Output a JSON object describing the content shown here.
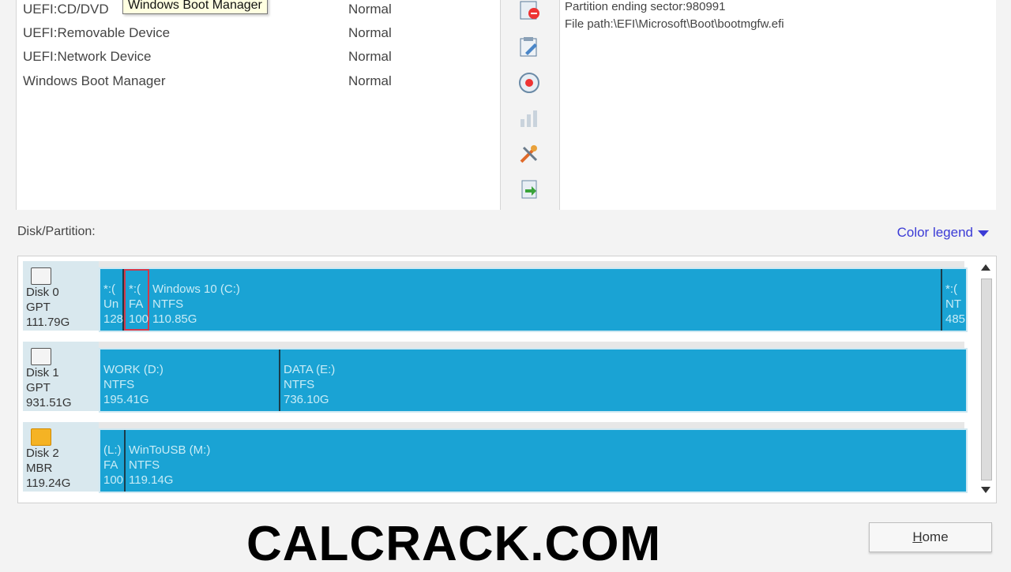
{
  "boot_entries": [
    {
      "name": "UEFI:CD/DVD",
      "status": "Normal"
    },
    {
      "name": "UEFI:Removable Device",
      "status": "Normal"
    },
    {
      "name": "UEFI:Network Device",
      "status": "Normal"
    },
    {
      "name": "Windows Boot Manager",
      "status": "Normal"
    }
  ],
  "tooltip": "Windows Boot Manager",
  "toolbar_icons": [
    "delete-entry-icon",
    "edit-entry-icon",
    "record-icon",
    "chart-icon",
    "tools-icon",
    "export-icon"
  ],
  "info": {
    "line1": "Partition ending sector:980991",
    "line2": "File path:\\EFI\\Microsoft\\Boot\\bootmgfw.efi"
  },
  "section_label": "Disk/Partition:",
  "color_legend": "Color legend",
  "disks": [
    {
      "name": "Disk 0",
      "scheme": "GPT",
      "size": "111.79G",
      "icon": "hard-disk-icon",
      "partitions": [
        {
          "label": "*:(",
          "fs": "Un",
          "size": "128"
        },
        {
          "label": "*:(",
          "fs": "FA",
          "size": "100"
        },
        {
          "label": "Windows 10 (C:)",
          "fs": "NTFS",
          "size": "110.85G"
        },
        {
          "label": "*:(",
          "fs": "NT",
          "size": "485"
        }
      ]
    },
    {
      "name": "Disk 1",
      "scheme": "GPT",
      "size": "931.51G",
      "icon": "hard-disk-icon",
      "partitions": [
        {
          "label": "WORK (D:)",
          "fs": "NTFS",
          "size": "195.41G"
        },
        {
          "label": "DATA (E:)",
          "fs": "NTFS",
          "size": "736.10G"
        }
      ]
    },
    {
      "name": "Disk 2",
      "scheme": "MBR",
      "size": "119.24G",
      "icon": "usb-drive-icon",
      "partitions": [
        {
          "label": "(L:)",
          "fs": "FA",
          "size": "100"
        },
        {
          "label": "WinToUSB (M:)",
          "fs": "NTFS",
          "size": "119.14G"
        }
      ]
    }
  ],
  "watermark": "CALCRACK.COM",
  "home_button": {
    "mnemonic": "H",
    "rest": "ome"
  },
  "colors": {
    "partition_fill": "#1aa3d4",
    "partition_text": "#c9ecf6",
    "selected_border": "#d3394a",
    "link": "#3b3bd6"
  }
}
